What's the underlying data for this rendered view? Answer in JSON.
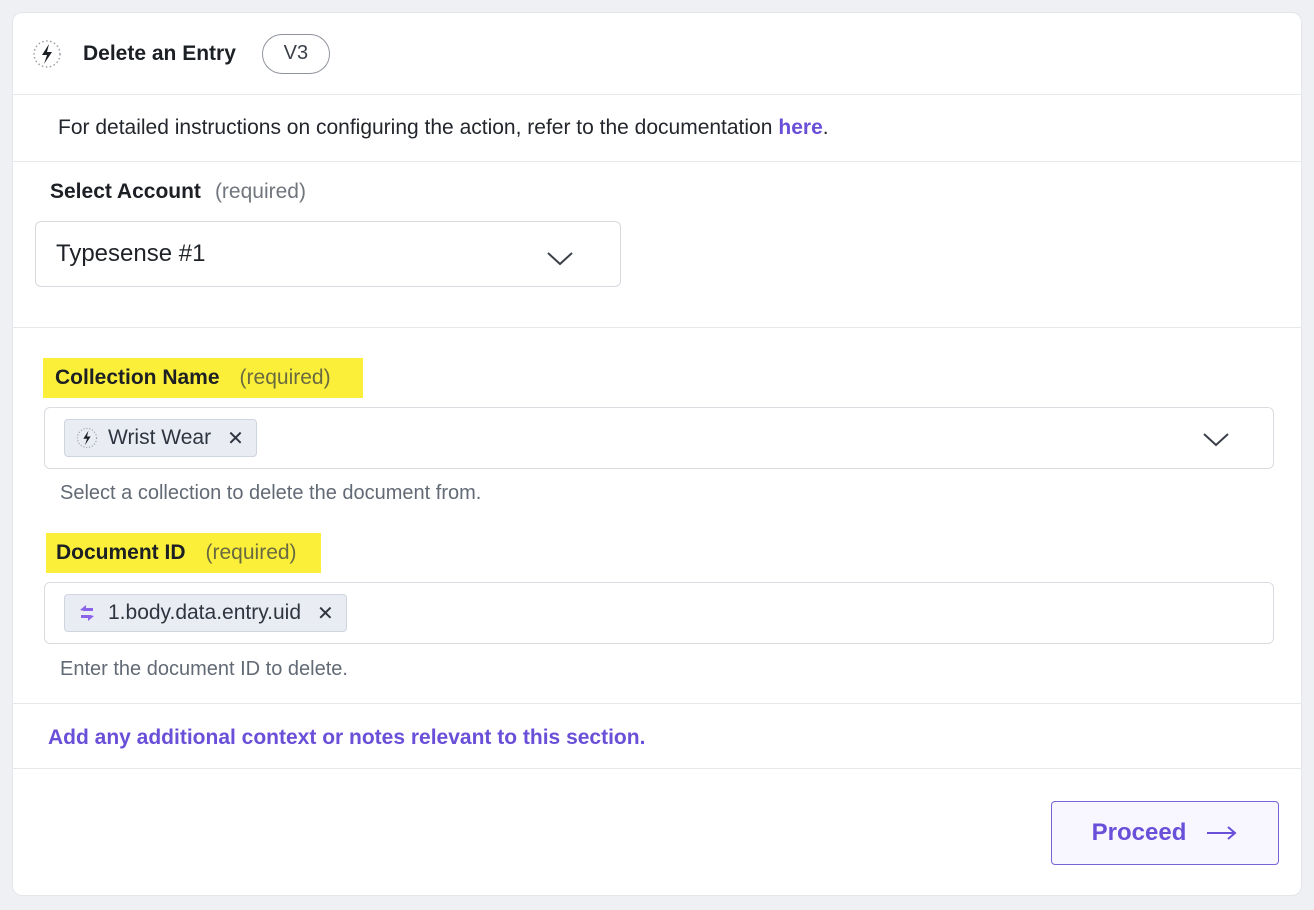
{
  "header": {
    "title": "Delete an Entry",
    "version": "V3",
    "app_icon": "typesense-lightning-icon"
  },
  "info": {
    "text": "For detailed instructions on configuring the action, refer to the documentation",
    "link_text": "here",
    "suffix": "."
  },
  "account": {
    "label": "Select Account",
    "required": "(required)",
    "value": "Typesense #1"
  },
  "collection": {
    "label": "Collection Name",
    "required": "(required)",
    "chip": "Wrist Wear",
    "help": "Select a collection to delete the document from."
  },
  "document": {
    "label": "Document ID",
    "required": "(required)",
    "chip": "1.body.data.entry.uid",
    "help": "Enter the document ID to delete."
  },
  "notes": {
    "text": "Add any additional context or notes relevant to this section."
  },
  "footer": {
    "proceed_label": "Proceed"
  },
  "colors": {
    "accent": "#6a4fd8",
    "highlight": "#fbef3a"
  }
}
